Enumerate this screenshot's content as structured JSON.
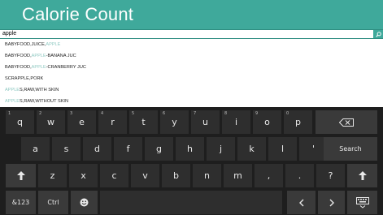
{
  "app": {
    "title": "Calorie Count"
  },
  "search": {
    "value": "apple"
  },
  "suggestions": [
    {
      "parts": [
        {
          "text": "BABYFOOD,JUICE,",
          "hl": false
        },
        {
          "text": "APPLE",
          "hl": true
        }
      ]
    },
    {
      "parts": [
        {
          "text": "BABYFOOD,",
          "hl": false
        },
        {
          "text": "APPLE",
          "hl": true
        },
        {
          "text": "-BANANA JUC",
          "hl": false
        }
      ]
    },
    {
      "parts": [
        {
          "text": "BABYFOOD,",
          "hl": false
        },
        {
          "text": "APPLE",
          "hl": true
        },
        {
          "text": "-CRANBERRY JUC",
          "hl": false
        }
      ]
    },
    {
      "parts": [
        {
          "text": "SCRAPPLE,PORK",
          "hl": false
        }
      ]
    },
    {
      "parts": [
        {
          "text": "APPLE",
          "hl": true
        },
        {
          "text": "S,RAW,WITH SKIN",
          "hl": false
        }
      ]
    },
    {
      "parts": [
        {
          "text": "APPLE",
          "hl": true
        },
        {
          "text": "S,RAW,WITHOUT SKIN",
          "hl": false
        }
      ]
    }
  ],
  "keyboard": {
    "row1": [
      {
        "label": "q",
        "sub": "1"
      },
      {
        "label": "w",
        "sub": "2"
      },
      {
        "label": "e",
        "sub": "3"
      },
      {
        "label": "r",
        "sub": "4"
      },
      {
        "label": "t",
        "sub": "5"
      },
      {
        "label": "y",
        "sub": "6"
      },
      {
        "label": "u",
        "sub": "7"
      },
      {
        "label": "i",
        "sub": "8"
      },
      {
        "label": "o",
        "sub": "9"
      },
      {
        "label": "p",
        "sub": "0"
      }
    ],
    "row2": [
      "a",
      "s",
      "d",
      "f",
      "g",
      "h",
      "j",
      "k",
      "l",
      "'"
    ],
    "row3": [
      "z",
      "x",
      "c",
      "v",
      "b",
      "n",
      "m",
      ",",
      ".",
      "?"
    ],
    "search_label": "Search",
    "symbols_label": "&123",
    "ctrl_label": "Ctrl"
  },
  "colors": {
    "accent": "#3fa99b",
    "keyboard_bg": "#1e1e1e",
    "key_bg": "#2e2e2e"
  }
}
